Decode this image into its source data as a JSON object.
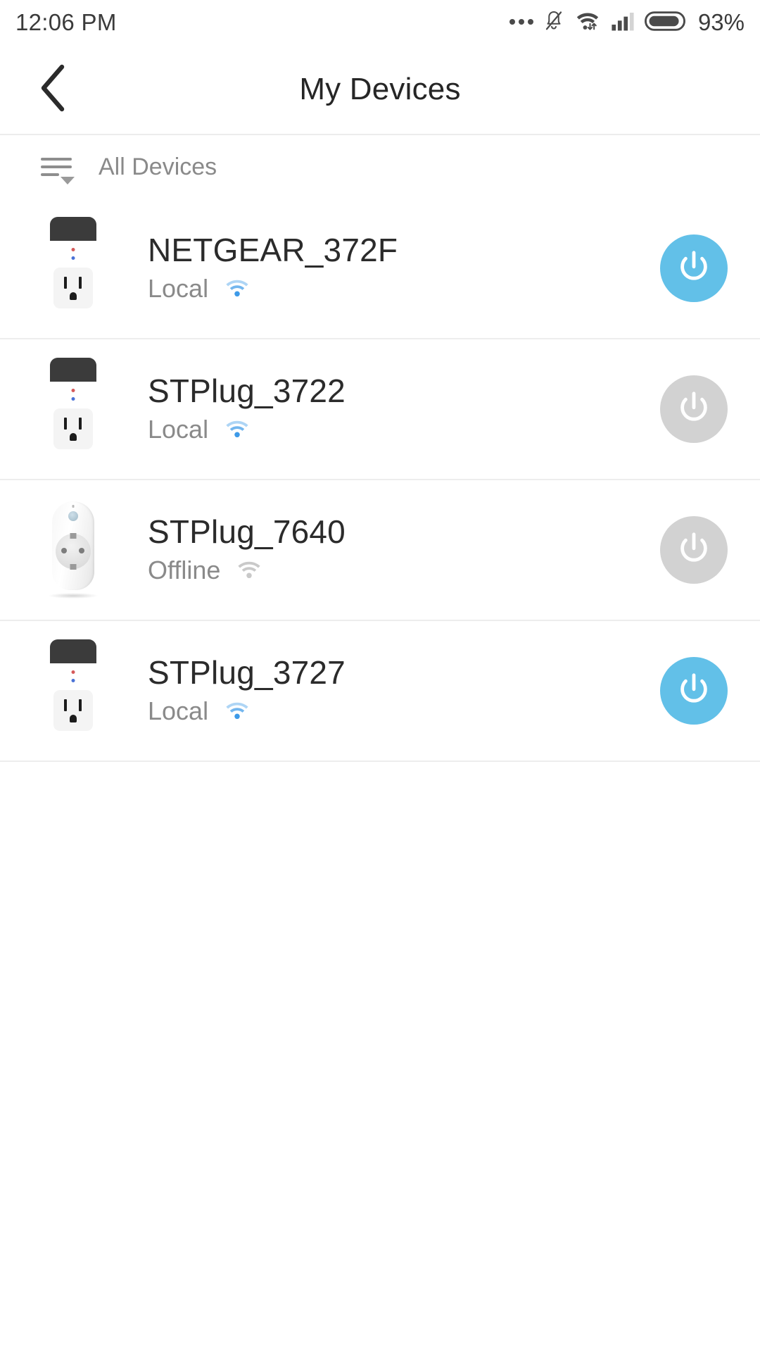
{
  "status_bar": {
    "time": "12:06 PM",
    "battery_percent": "93%",
    "icons": [
      "more-dots-icon",
      "bell-muted-icon",
      "wifi-icon",
      "cellular-signal-icon",
      "battery-icon"
    ]
  },
  "header": {
    "back_icon": "chevron-left-icon",
    "title": "My Devices"
  },
  "filter": {
    "icon": "filter-sort-icon",
    "label": "All Devices"
  },
  "colors": {
    "power_on": "#62c0e8",
    "power_off": "#d2d2d2",
    "wifi_active": "#3d9ae8",
    "wifi_inactive": "#c9c9c9",
    "status_text": "#8a8a8a",
    "device_name": "#2b2b2b"
  },
  "devices": [
    {
      "name": "NETGEAR_372F",
      "status": "Local",
      "wifi": "wifi-icon",
      "wifi_active": true,
      "power_state": "on",
      "thumb_type": "us-plug"
    },
    {
      "name": "STPlug_3722",
      "status": "Local",
      "wifi": "wifi-icon",
      "wifi_active": true,
      "power_state": "off",
      "thumb_type": "us-plug"
    },
    {
      "name": "STPlug_7640",
      "status": "Offline",
      "wifi": "wifi-icon",
      "wifi_active": false,
      "power_state": "off",
      "thumb_type": "eu-plug"
    },
    {
      "name": "STPlug_3727",
      "status": "Local",
      "wifi": "wifi-icon",
      "wifi_active": true,
      "power_state": "on",
      "thumb_type": "us-plug"
    }
  ]
}
